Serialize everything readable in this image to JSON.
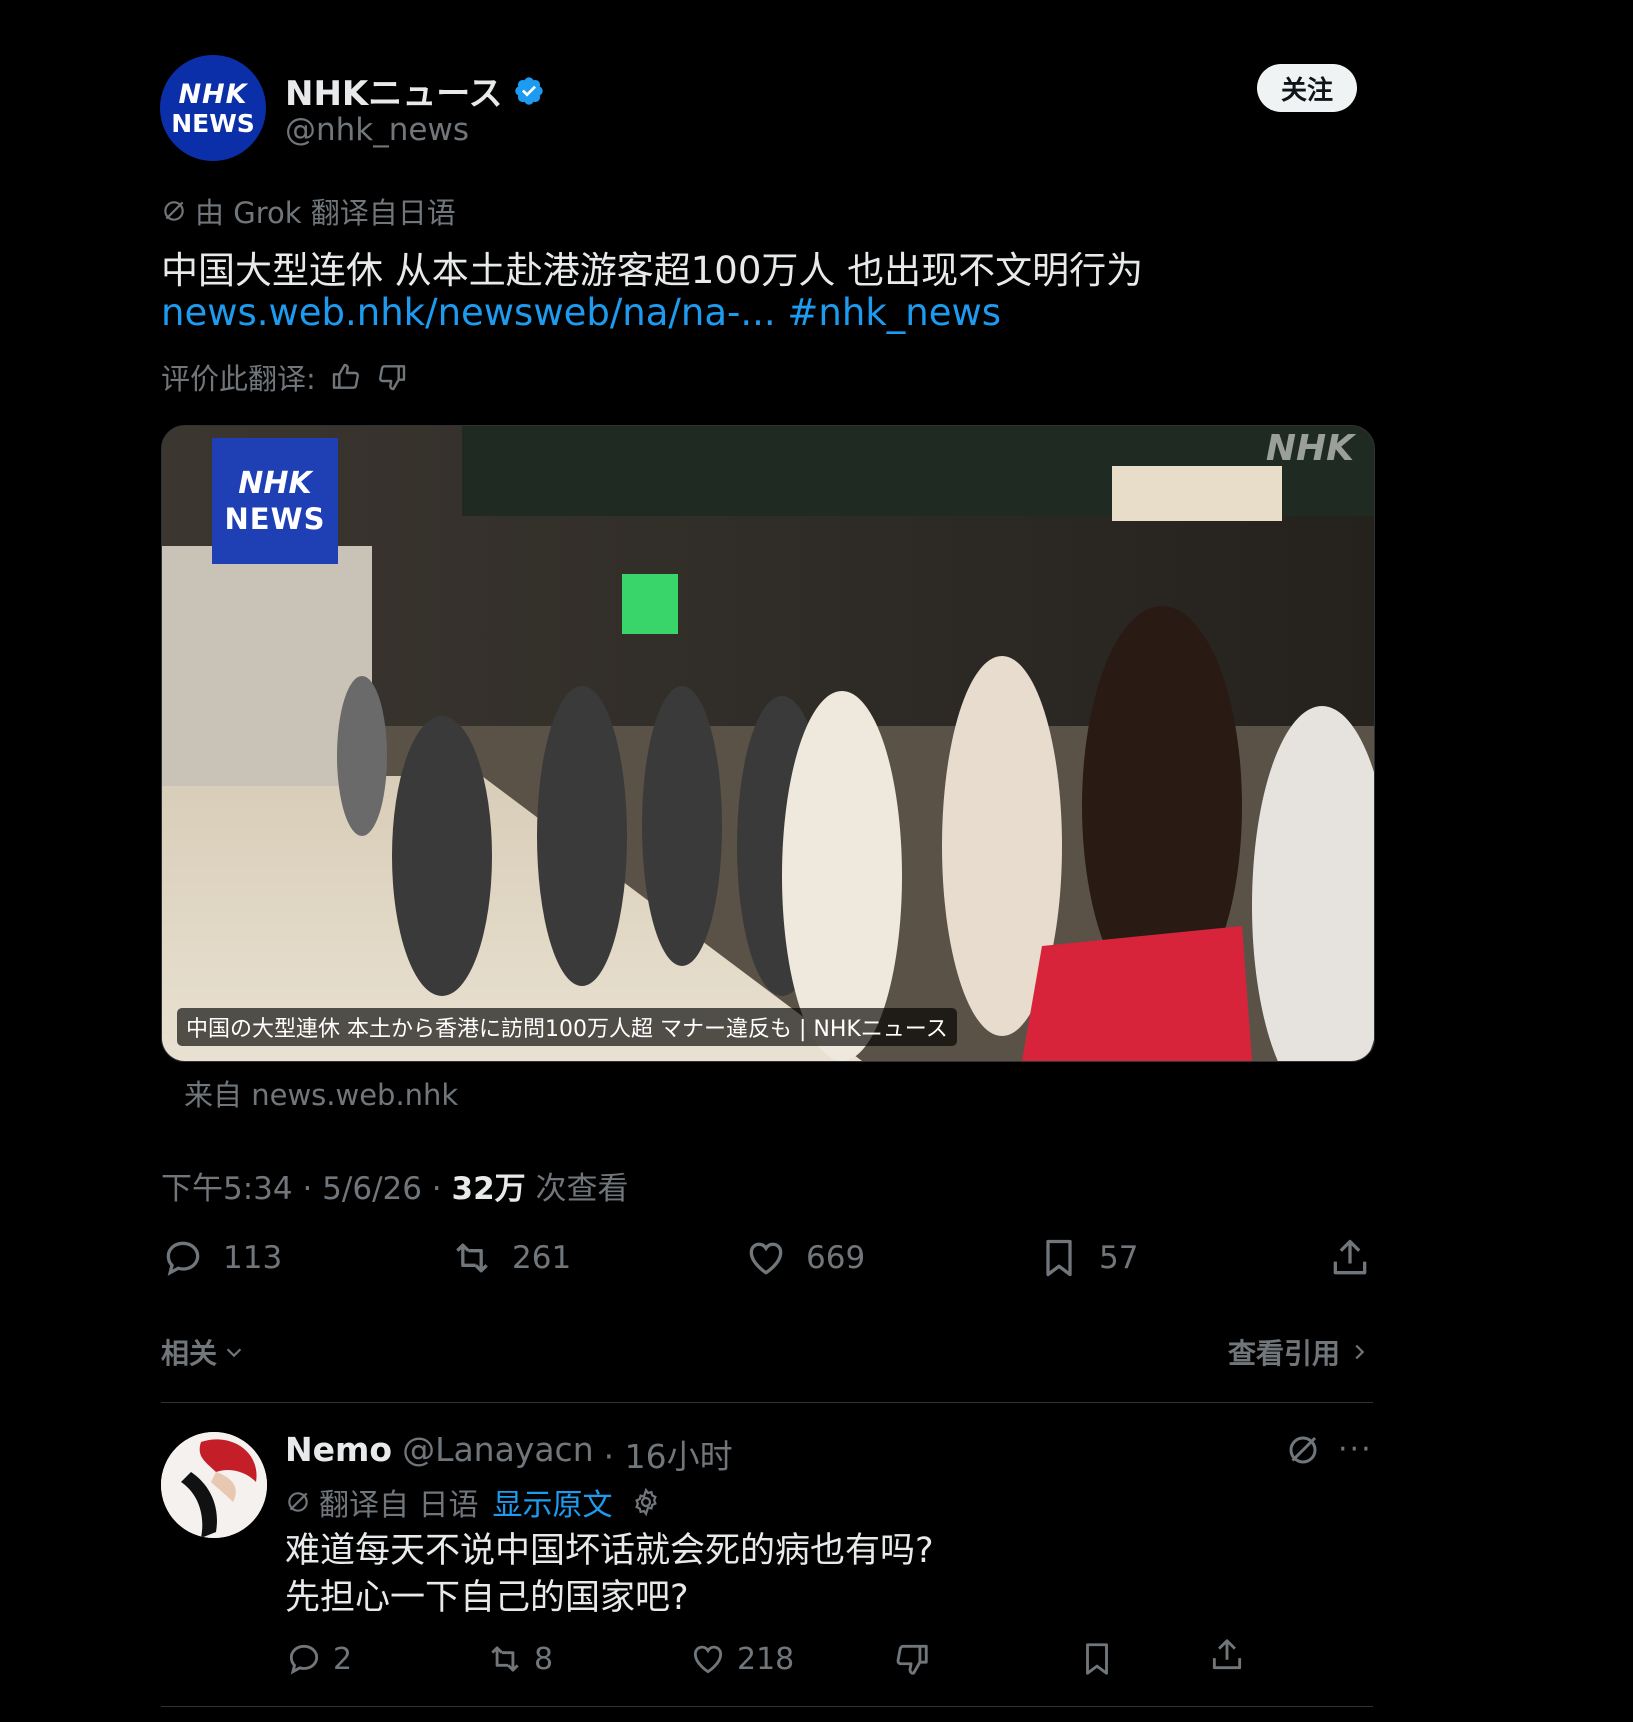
{
  "author": {
    "avatar_line1": "NHK",
    "avatar_line2": "NEWS",
    "name": "NHKニュース",
    "handle": "@nhk_news",
    "follow_label": "关注"
  },
  "tweet": {
    "translated_by": "由 Grok 翻译自日语",
    "text": "中国大型连休 从本土赴港游客超100万人 也出现不文明行为",
    "link": "news.web.nhk/newsweb/na/na-...",
    "hashtag": "#nhk_news",
    "rate_label": "评价此翻译:"
  },
  "card": {
    "logo_line1": "NHK",
    "logo_line2": "NEWS",
    "watermark": "NHK",
    "caption": "中国の大型連休 本土から香港に訪問100万人超 マナー違反も | NHKニュース",
    "from": "来自 news.web.nhk"
  },
  "meta": {
    "time": "下午5:34 · 5/6/26 · ",
    "views": "32万",
    "views_label": " 次查看"
  },
  "actions": {
    "replies": "113",
    "reposts": "261",
    "likes": "669",
    "bookmarks": "57"
  },
  "related": {
    "related_label": "相关",
    "quotes_label": "查看引用"
  },
  "reply": {
    "name": "Nemo",
    "handle": "@Lanayacn",
    "time": "· 16小时",
    "more": "···",
    "translated_from": "翻译自 日语",
    "show_original": "显示原文",
    "line1": "难道每天不说中国坏话就会死的病也有吗?",
    "line2": "先担心一下自己的国家吧?",
    "replies": "2",
    "reposts": "8",
    "likes": "218"
  },
  "colors": {
    "background": "#000000",
    "text": "#e7e9ea",
    "muted": "#71767b",
    "link": "#1d9bf0",
    "nhk_blue": "#0b2fa8"
  }
}
